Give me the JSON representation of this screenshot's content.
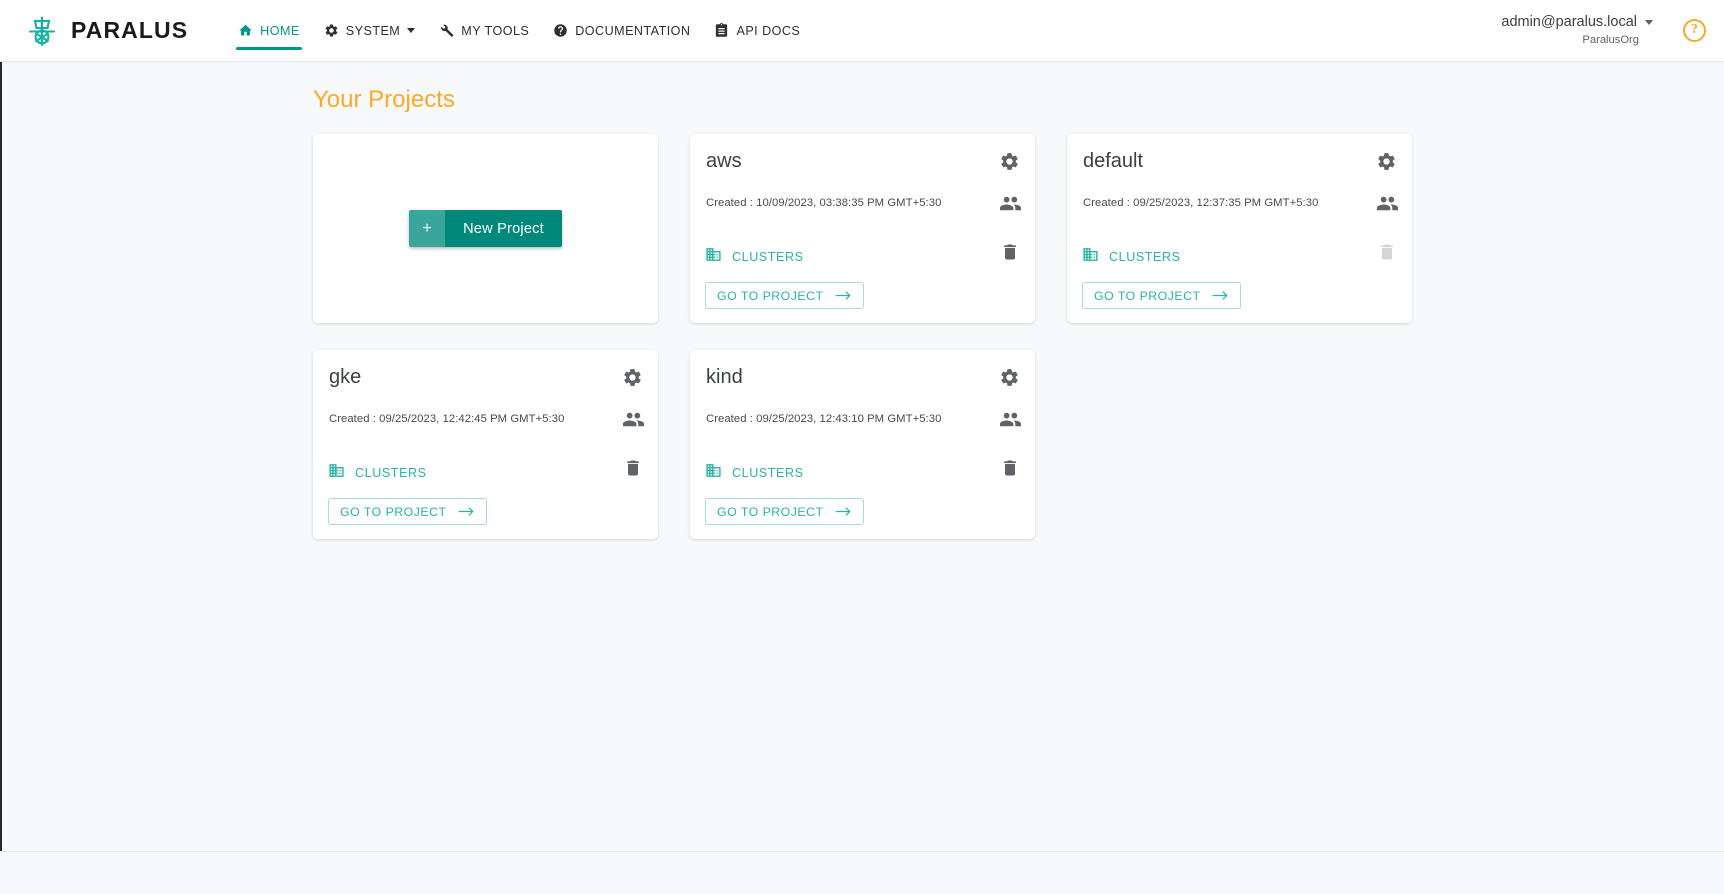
{
  "header": {
    "brand": {
      "name": "PARALUS",
      "logo_icon": "paralus-anchor-logo"
    },
    "nav": [
      {
        "label": "HOME",
        "icon": "home-icon",
        "active": true,
        "caret": false
      },
      {
        "label": "SYSTEM",
        "icon": "gear-icon",
        "active": false,
        "caret": true
      },
      {
        "label": "MY TOOLS",
        "icon": "wrench-icon",
        "active": false,
        "caret": false
      },
      {
        "label": "DOCUMENTATION",
        "icon": "help-circle-icon",
        "active": false,
        "caret": false
      },
      {
        "label": "API DOCS",
        "icon": "clipboard-icon",
        "active": false,
        "caret": false
      }
    ],
    "user": {
      "email": "admin@paralus.local",
      "org": "ParalusOrg",
      "caret_icon": "chevron-down-icon"
    },
    "help": {
      "glyph": "?",
      "icon": "help-icon",
      "color": "#f9a825"
    }
  },
  "main": {
    "page_title": "Your Projects",
    "title_color": "#ffa726",
    "new_project": {
      "plus_glyph": "+",
      "label": "New Project",
      "plus_color": "#3aa69b",
      "label_color": "#00897b"
    },
    "card_labels": {
      "clusters": "CLUSTERS",
      "goto": "GO TO PROJECT",
      "created_prefix": "Created : ",
      "arrow_glyph": "→"
    },
    "projects": [
      {
        "name": "aws",
        "created": "Created : 10/09/2023, 03:38:35 PM GMT+5:30",
        "clusters": "CLUSTERS",
        "goto": "GO TO PROJECT",
        "delete_enabled": true
      },
      {
        "name": "default",
        "created": "Created : 09/25/2023, 12:37:35 PM GMT+5:30",
        "clusters": "CLUSTERS",
        "goto": "GO TO PROJECT",
        "delete_enabled": false
      },
      {
        "name": "gke",
        "created": "Created : 09/25/2023, 12:42:45 PM GMT+5:30",
        "clusters": "CLUSTERS",
        "goto": "GO TO PROJECT",
        "delete_enabled": true
      },
      {
        "name": "kind",
        "created": "Created : 09/25/2023, 12:43:10 PM GMT+5:30",
        "clusters": "CLUSTERS",
        "goto": "GO TO PROJECT",
        "delete_enabled": true
      }
    ]
  },
  "colors": {
    "teal": "#009688",
    "teal_light": "#2bb3a3",
    "orange": "#ffa726",
    "page_bg": "#f7f9fa"
  }
}
